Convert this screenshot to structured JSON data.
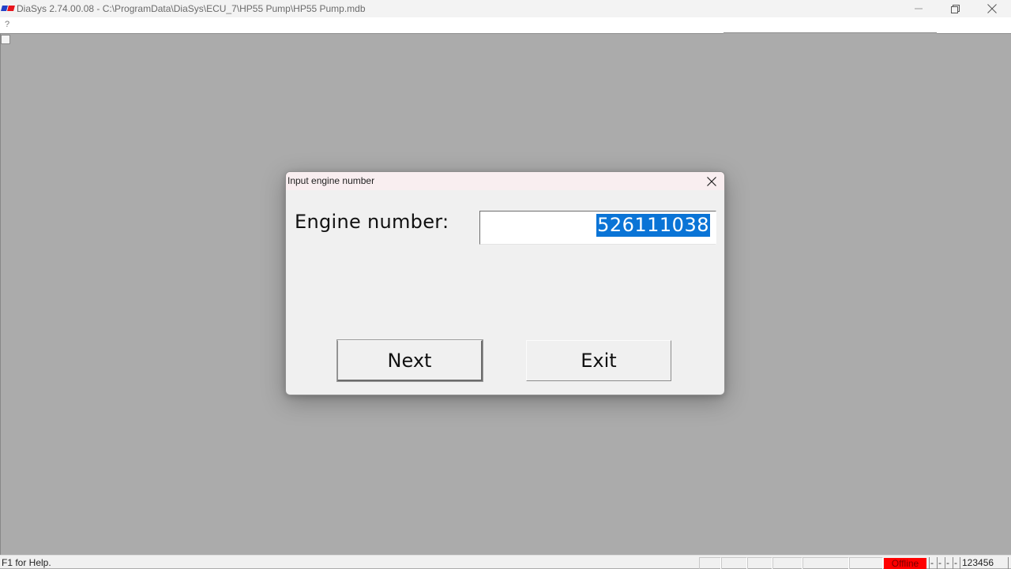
{
  "window": {
    "title": "DiaSys 2.74.00.08 - C:\\ProgramData\\DiaSys\\ECU_7\\HP55 Pump\\HP55 Pump.mdb",
    "app_icon": "diasys-logo-icon",
    "controls": {
      "minimize": "minimize-icon",
      "maximize": "restore-icon",
      "close": "close-icon"
    }
  },
  "menubar": {
    "items": [
      {
        "label": "?"
      }
    ]
  },
  "dialog": {
    "title": "Input engine number",
    "close_icon": "close-icon",
    "field_label": "Engine number:",
    "field_value": "526111038",
    "field_selected": true,
    "buttons": {
      "next": "Next",
      "exit": "Exit"
    },
    "selection_color": "#0a74d6"
  },
  "statusbar": {
    "help_text": "F1 for Help.",
    "connection_status": "Offline",
    "connection_color": "#ff0000",
    "indicators": [
      "-",
      "-",
      "-",
      "-"
    ],
    "code": "123456"
  }
}
